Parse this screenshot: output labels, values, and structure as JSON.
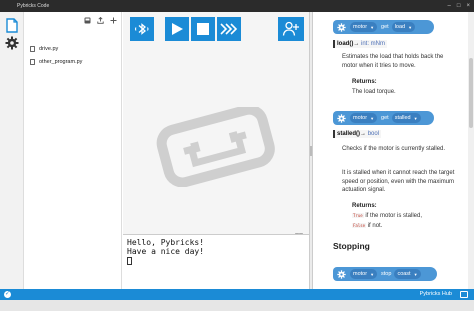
{
  "window": {
    "title": "Pybricks Code"
  },
  "activity_bar": {
    "items": [
      {
        "icon": "file-icon"
      },
      {
        "icon": "gear-icon"
      }
    ]
  },
  "explorer": {
    "toolbar": [
      {
        "icon": "archive-icon"
      },
      {
        "icon": "export-icon"
      },
      {
        "icon": "plus-icon"
      }
    ],
    "files": [
      "drive.py",
      "other_program.py"
    ]
  },
  "toolbar": {
    "buttons": [
      {
        "icon": "bluetooth-icon"
      },
      {
        "icon": "play-icon"
      },
      {
        "icon": "stop-icon"
      },
      {
        "icon": "fast-forward-icon"
      }
    ],
    "add_hub": {
      "icon": "add-person-icon"
    }
  },
  "terminal": {
    "lines": [
      "Hello, Pybricks!",
      "Have a nice day!"
    ]
  },
  "docs": {
    "blocks": [
      {
        "object": "motor",
        "verb": "get",
        "field": "load"
      },
      {
        "object": "motor",
        "verb": "get",
        "field": "stalled"
      },
      {
        "object": "motor",
        "verb": "stop",
        "field": "coast"
      }
    ],
    "load": {
      "name": "load()",
      "arrow": "→",
      "type": "int: mNm",
      "desc": "Estimates the load that holds back the motor when it tries to move.",
      "returns_label": "Returns:",
      "returns": "The load torque."
    },
    "stalled": {
      "name": "stalled()",
      "arrow": "→",
      "type": "bool",
      "desc1": "Checks if the motor is currently stalled.",
      "desc2": "It is stalled when it cannot reach the target speed or position, even with the maximum actuation signal.",
      "returns_label": "Returns:",
      "ret_true_code": "True",
      "ret_true_text": "if the motor is stalled,",
      "ret_false_code": "False",
      "ret_false_text": "if not."
    },
    "section_heading": "Stopping"
  },
  "statusbar": {
    "hub": "Pybricks Hub"
  },
  "colors": {
    "accent": "#1b8bd6",
    "block": "#4c97d6",
    "block_pill": "#3a7fc0"
  }
}
